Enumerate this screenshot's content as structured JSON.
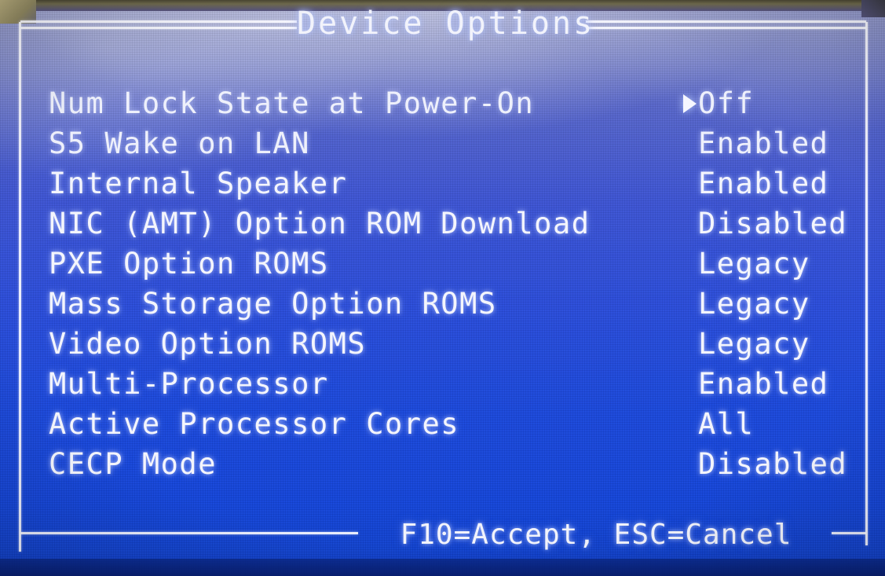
{
  "screen": {
    "title": "Device Options",
    "footer_hint": "F10=Accept, ESC=Cancel",
    "background_color": "#1a46d6",
    "text_color": "#f4f5fc",
    "cursor_glyph": "▶"
  },
  "options": [
    {
      "label": "Num Lock State at Power-On",
      "value": "Off",
      "selected": true
    },
    {
      "label": "S5 Wake on LAN",
      "value": "Enabled",
      "selected": false
    },
    {
      "label": "Internal Speaker",
      "value": "Enabled",
      "selected": false
    },
    {
      "label": "NIC (AMT) Option ROM Download",
      "value": "Disabled",
      "selected": false
    },
    {
      "label": "PXE Option ROMS",
      "value": "Legacy",
      "selected": false
    },
    {
      "label": "Mass Storage Option ROMS",
      "value": "Legacy",
      "selected": false
    },
    {
      "label": "Video Option ROMS",
      "value": "Legacy",
      "selected": false
    },
    {
      "label": "Multi-Processor",
      "value": "Enabled",
      "selected": false
    },
    {
      "label": "Active Processor Cores",
      "value": "All",
      "selected": false
    },
    {
      "label": "CECP Mode",
      "value": "Disabled",
      "selected": false
    }
  ]
}
